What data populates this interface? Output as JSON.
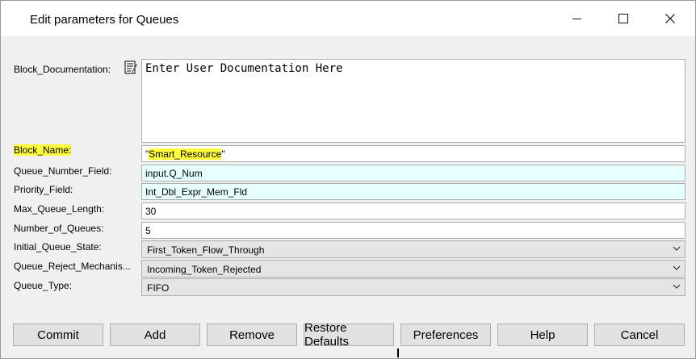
{
  "window": {
    "title": "Edit parameters for Queues"
  },
  "labels": {
    "block_documentation": "Block_Documentation:",
    "block_name": "Block_Name:",
    "queue_number_field": "Queue_Number_Field:",
    "priority_field": "Priority_Field:",
    "max_queue_length": "Max_Queue_Length:",
    "number_of_queues": "Number_of_Queues:",
    "initial_queue_state": "Initial_Queue_State:",
    "queue_reject_mechanism": "Queue_Reject_Mechanis...",
    "queue_type": "Queue_Type:"
  },
  "values": {
    "block_documentation": "Enter User Documentation Here",
    "block_name_quote_open": "\"",
    "block_name_text": "Smart_Resource",
    "block_name_quote_close": "\"",
    "queue_number_field": "input.Q_Num",
    "priority_field": "Int_Dbl_Expr_Mem_Fld",
    "max_queue_length": "30",
    "number_of_queues": "5",
    "initial_queue_state": "First_Token_Flow_Through",
    "queue_reject_mechanism": "Incoming_Token_Rejected",
    "queue_type": "FIFO"
  },
  "buttons": {
    "commit": "Commit",
    "add": "Add",
    "remove": "Remove",
    "restore_defaults": "Restore Defaults",
    "preferences": "Preferences",
    "help": "Help",
    "cancel": "Cancel"
  },
  "icons": {
    "minimize": "minimize-icon",
    "maximize": "maximize-icon",
    "close": "close-icon",
    "edit_doc": "edit-document-icon",
    "dropdown": "chevron-down-icon"
  },
  "colors": {
    "highlight": "#ffff3a",
    "expression_field_bg": "#e6ffff"
  }
}
